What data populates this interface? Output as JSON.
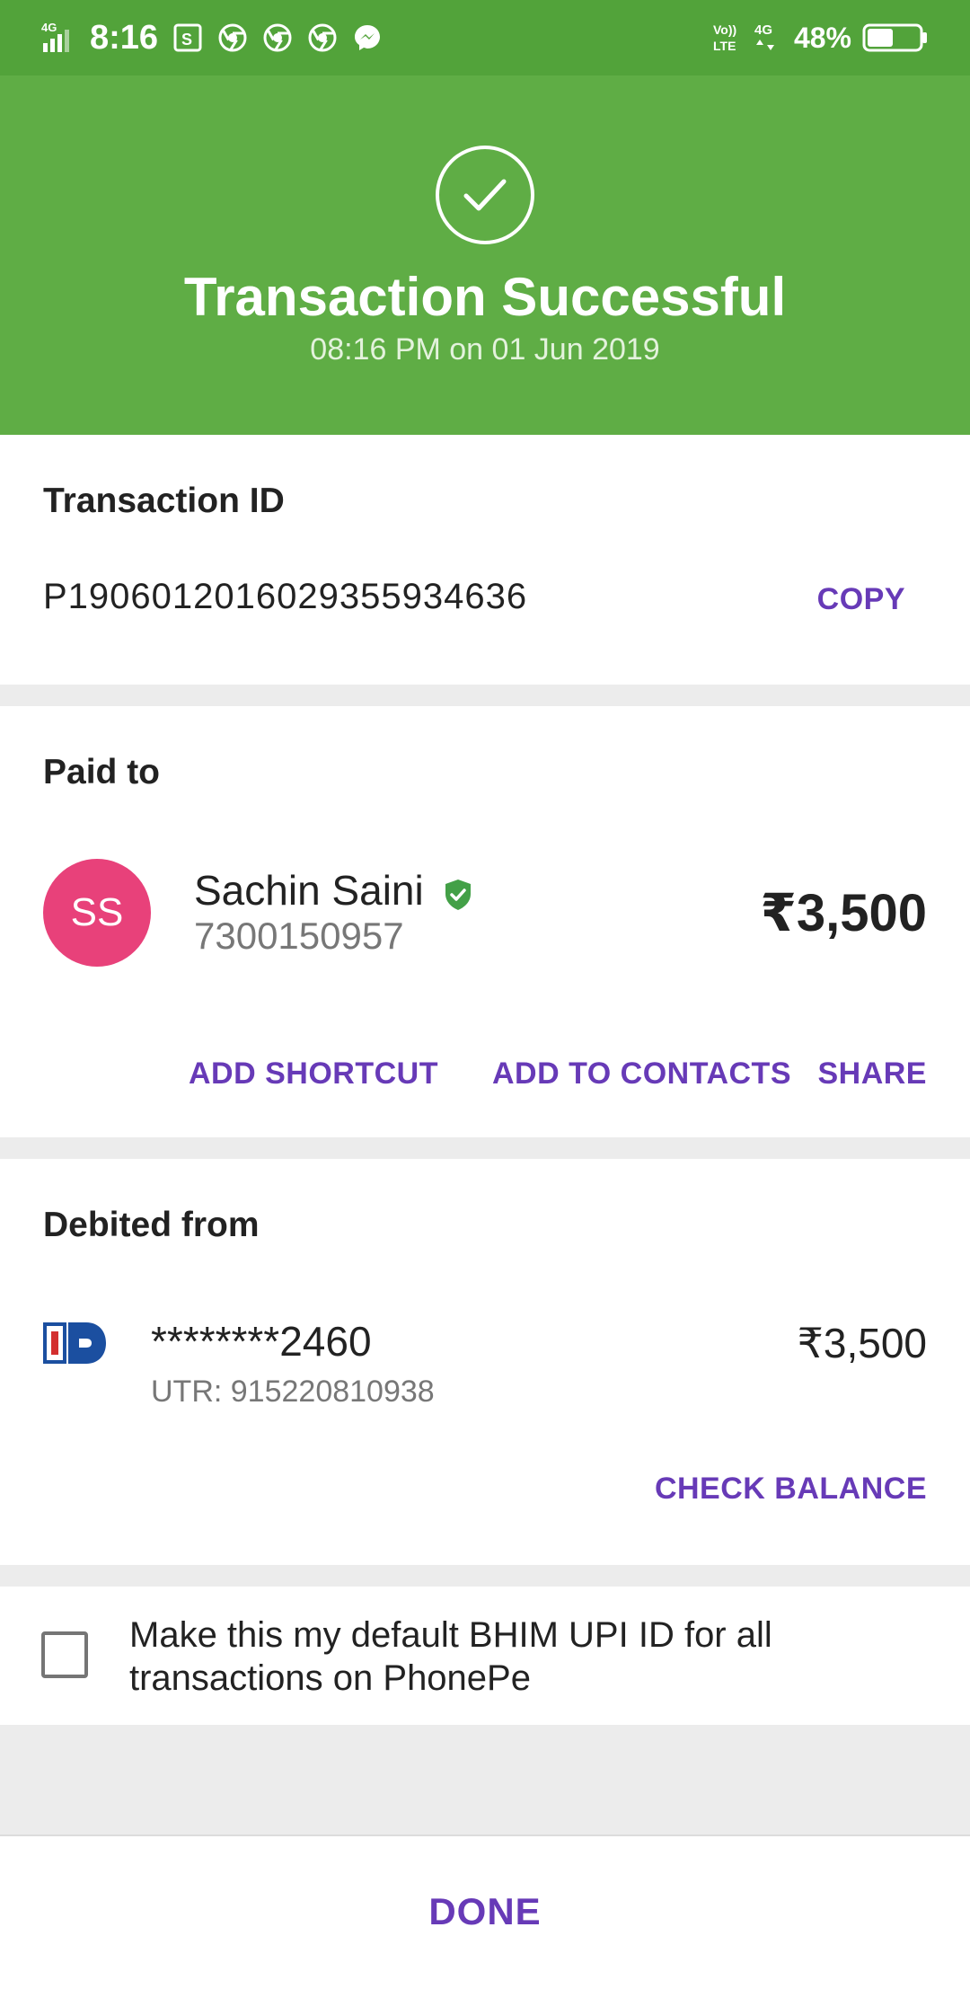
{
  "status_bar": {
    "network": "4G",
    "time": "8:16",
    "notification_icons": [
      "screenshot-icon",
      "chrome-icon",
      "chrome-icon",
      "chrome-icon",
      "messenger-icon"
    ],
    "volte": "VoLTE",
    "data": "4G",
    "battery_percent": "48%"
  },
  "header": {
    "title": "Transaction Successful",
    "subtitle": "08:16 PM on 01 Jun 2019",
    "background_color": "#5fad45"
  },
  "transaction": {
    "label": "Transaction ID",
    "id": "P1906012016029355934636",
    "copy_label": "COPY"
  },
  "paid_to": {
    "label": "Paid to",
    "initials": "SS",
    "name": "Sachin Saini",
    "phone": "7300150957",
    "amount": "₹3,500",
    "avatar_color": "#e8417a",
    "actions": {
      "add_shortcut": "ADD SHORTCUT",
      "add_to_contacts": "ADD TO CONTACTS",
      "share": "SHARE"
    }
  },
  "debited_from": {
    "label": "Debited from",
    "account": "********2460",
    "utr": "UTR: 915220810938",
    "amount": "₹3,500",
    "check_balance": "CHECK BALANCE"
  },
  "default_option": {
    "checked": false,
    "text": "Make this my default BHIM UPI ID for all transactions on PhonePe"
  },
  "footer": {
    "done_label": "DONE"
  },
  "accent_color": "#673ab7"
}
